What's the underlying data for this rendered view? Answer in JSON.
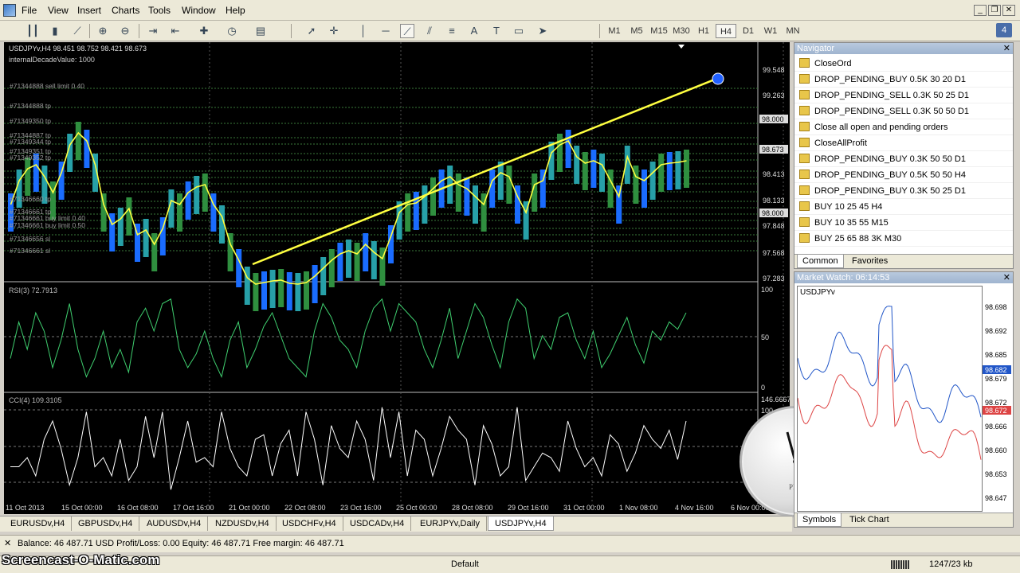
{
  "menu": [
    "File",
    "View",
    "Insert",
    "Charts",
    "Tools",
    "Window",
    "Help"
  ],
  "timeframes": [
    "M1",
    "M5",
    "M15",
    "M30",
    "H1",
    "H4",
    "D1",
    "W1",
    "MN"
  ],
  "active_timeframe": "H4",
  "chart": {
    "header": "USDJPYv,H4  98.451 98.752 98.421 98.673",
    "overlay_text": "internalDecadeValue: 1000",
    "price_ticks": [
      "99.548",
      "99.263",
      "98.973",
      "98.673",
      "98.413",
      "98.133",
      "97.848",
      "97.568",
      "97.283"
    ],
    "highlighted_prices": [
      "98.000",
      "98.673",
      "98.000"
    ],
    "order_labels": [
      "#71344888 sell limit 0.40",
      "#71344888 tp",
      "#71349350 tp",
      "#71344887 tp",
      "#71349344 tp",
      "#71349351 tp",
      "#71349352 tp",
      "#71346660 tp",
      "#71346661 tp",
      "#71346661 buy limit 0.40",
      "#71346661 buy limit 0.50",
      "#71346656 sl",
      "#71346661 sl"
    ],
    "rsi_label": "RSI(3) 72.7913",
    "rsi_ticks": [
      "100",
      "50",
      "0"
    ],
    "cci_label": "CCI(4) 109.3105",
    "cci_ticks": [
      "146.6667",
      "100",
      "0"
    ],
    "time_axis": [
      "11 Oct 2013",
      "15 Oct 00:00",
      "16 Oct 08:00",
      "17 Oct 16:00",
      "21 Oct 00:00",
      "22 Oct 08:00",
      "23 Oct 16:00",
      "25 Oct 00:00",
      "28 Oct 08:00",
      "29 Oct 16:00",
      "31 Oct 00:00",
      "1 Nov 08:00",
      "4 Nov 16:00",
      "6 Nov 00:00"
    ]
  },
  "navigator": {
    "title": "Navigator",
    "items": [
      "CloseOrd",
      "DROP_PENDING_BUY  0.5K 30 20  D1",
      "DROP_PENDING_SELL  0.3K 50 25  D1",
      "DROP_PENDING_SELL  0.3K 50 50  D1",
      "Close all open and pending orders",
      "CloseAllProfit",
      "DROP_PENDING_BUY  0.3K 50 50  D1",
      "DROP_PENDING_BUY  0.5K 50 50  H4",
      "DROP_PENDING_BUY  0.3K 50 25  D1",
      "BUY  10   25   45  H4",
      "BUY  10   35   55  M15",
      "BUY  25 65 88  3K M30"
    ],
    "tabs": [
      "Common",
      "Favorites"
    ]
  },
  "market_watch": {
    "title": "Market Watch: 06:14:53",
    "symbol": "USDJPYv",
    "ticks": [
      "98.698",
      "98.692",
      "98.685",
      "98.679",
      "98.672",
      "98.666",
      "98.660",
      "98.653",
      "98.647"
    ],
    "ask": "98.682",
    "bid": "98.672",
    "tabs": [
      "Symbols",
      "Tick Chart"
    ]
  },
  "chart_tabs": [
    "EURUSDv,H4",
    "GBPUSDv,H4",
    "AUDUSDv,H4",
    "NZDUSDv,H4",
    "USDCHFv,H4",
    "USDCADv,H4",
    "EURJPYv,Daily",
    "USDJPYv,H4"
  ],
  "active_chart_tab": "USDJPYv,H4",
  "terminal": "Balance: 46 487.71 USD  Profit/Loss: 0.00  Equity: 46 487.71  Free margin: 46 487.71",
  "status": {
    "profile": "Default",
    "traffic": "1247/23 kb"
  },
  "watermark": "Screencast-O-Matic.com",
  "clock_label": "PM"
}
